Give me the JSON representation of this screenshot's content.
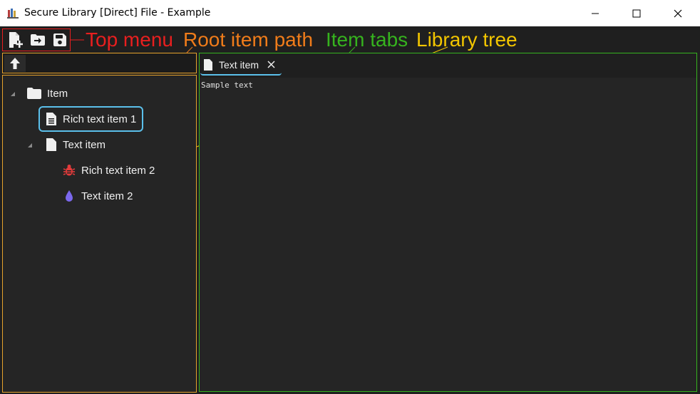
{
  "window": {
    "title": "Secure Library [Direct] File - Example",
    "controls": {
      "minimize_icon": "minimize-icon",
      "maximize_icon": "maximize-icon",
      "close_icon": "close-icon"
    }
  },
  "top_menu": {
    "buttons": [
      {
        "name": "new-file-icon"
      },
      {
        "name": "open-file-icon"
      },
      {
        "name": "save-icon"
      }
    ]
  },
  "annotations": {
    "top_menu": "Top menu",
    "root_item_path": "Root item path",
    "item_tabs": "Item tabs",
    "library_tree": "Library tree",
    "colors": {
      "top_menu": "#e81f1f",
      "root_item_path": "#f07c1a",
      "item_tabs": "#36b31e",
      "library_tree": "#f2c500"
    }
  },
  "root_path": {
    "up_icon": "arrow-up-icon",
    "value": ""
  },
  "tree": {
    "items": [
      {
        "label": "Item",
        "icon": "folder-icon",
        "expanded": true
      },
      {
        "label": "Rich text item 1",
        "icon": "rich-text-document-icon",
        "selected": true
      },
      {
        "label": "Text item",
        "icon": "document-icon",
        "expanded": true
      },
      {
        "label": "Rich text item 2",
        "icon": "bug-icon",
        "color": "#e33b3b"
      },
      {
        "label": "Text item 2",
        "icon": "drop-icon",
        "color": "#7b68ee"
      }
    ]
  },
  "tabs": {
    "items": [
      {
        "label": "Text item",
        "icon": "document-icon"
      }
    ],
    "content": "Sample text",
    "accent": "#5bc0eb"
  }
}
